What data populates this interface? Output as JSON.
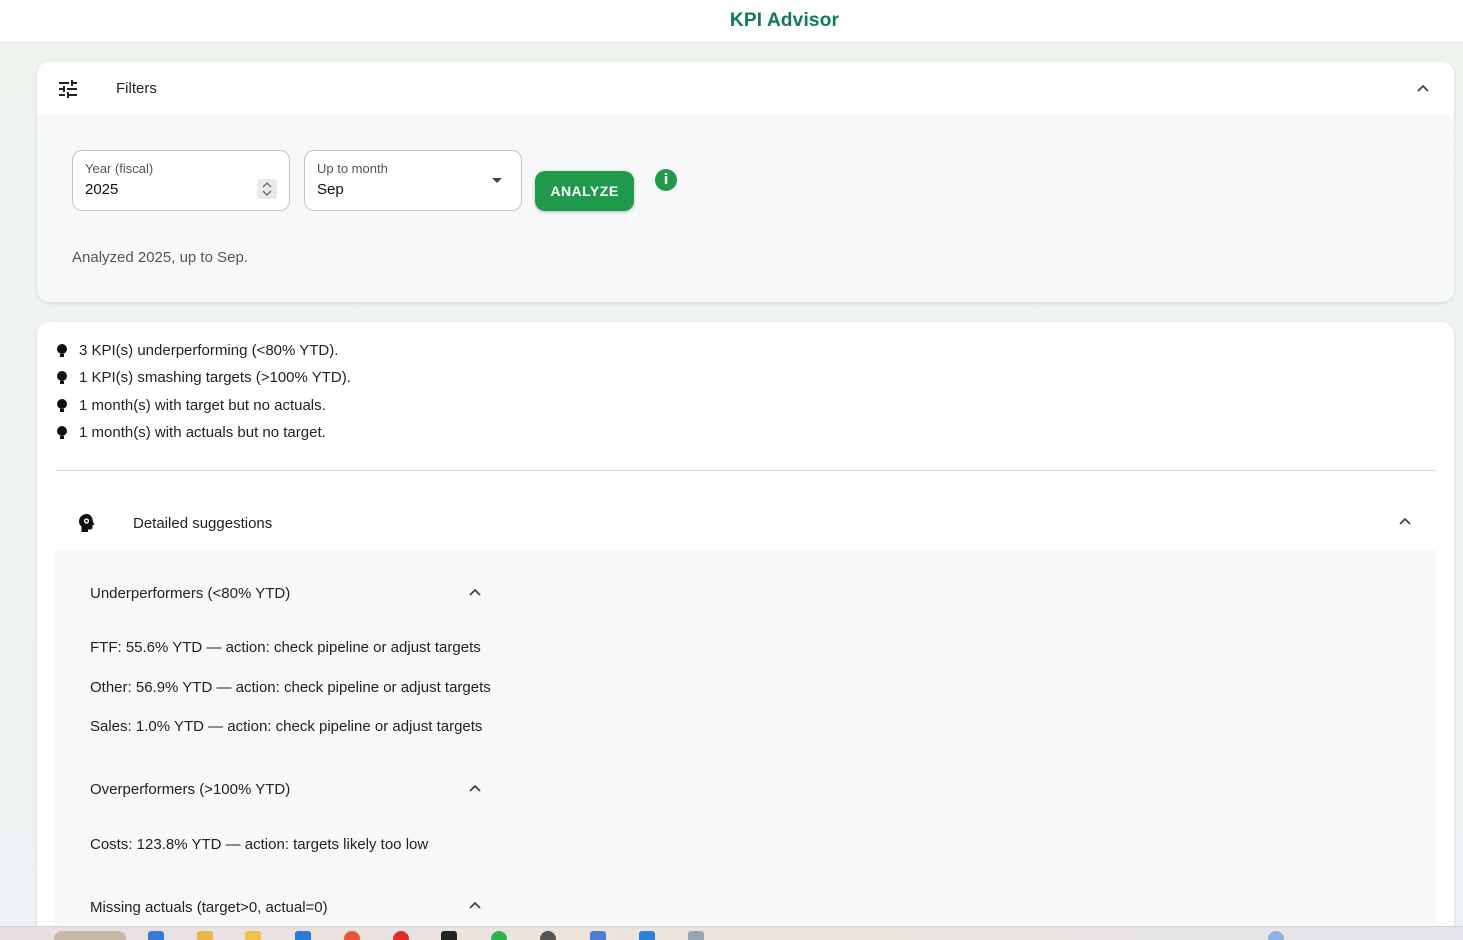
{
  "app": {
    "title": "KPI Advisor"
  },
  "filters": {
    "title": "Filters",
    "year": {
      "label": "Year (fiscal)",
      "value": "2025"
    },
    "month": {
      "label": "Up to month",
      "value": "Sep"
    },
    "analyze_label": "ANALYZE",
    "info_glyph": "i",
    "status": "Analyzed 2025, up to Sep."
  },
  "insights": [
    "3 KPI(s) underperforming (<80% YTD).",
    "1 KPI(s) smashing targets (>100% YTD).",
    "1 month(s) with target but no actuals.",
    "1 month(s) with actuals but no target."
  ],
  "suggestions": {
    "title": "Detailed suggestions",
    "sections": [
      {
        "title": "Underperformers (<80% YTD)",
        "items": [
          "FTF: 55.6% YTD — action: check pipeline or adjust targets",
          "Other: 56.9% YTD — action: check pipeline or adjust targets",
          "Sales: 1.0% YTD — action: check pipeline or adjust targets"
        ]
      },
      {
        "title": "Overperformers (>100% YTD)",
        "items": [
          "Costs: 123.8% YTD — action: targets likely too low"
        ]
      },
      {
        "title": "Missing actuals (target>0, actual=0)",
        "items": []
      }
    ]
  },
  "colors": {
    "brand": "#0f7a55",
    "accent": "#1e9a4a"
  },
  "icons": {
    "filters": "tune-icon",
    "collapse": "chevron-up-icon",
    "insight": "lightbulb-icon",
    "suggestions": "psychology-icon",
    "info": "info-icon",
    "dropdown": "caret-down-icon"
  }
}
